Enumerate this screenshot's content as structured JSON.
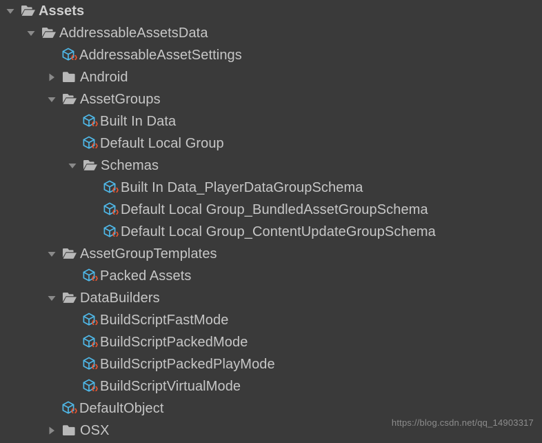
{
  "window": {
    "title": "Project Tree",
    "background_color": "#3a3a3a",
    "text_color": "#c6c6c6",
    "folder_color": "#b8b8b8",
    "twisty_color": "#8a8a8a",
    "cube_color": "#4fb8e8",
    "brace_color": "#f0552f"
  },
  "watermark": {
    "text": "https://blog.csdn.net/qq_14903317"
  },
  "tree": {
    "rows": [
      {
        "label": "Assets",
        "depth": 0,
        "icon": "folder-open-icon",
        "twisty": "chevron-down-icon",
        "bold": true
      },
      {
        "label": "AddressableAssetsData",
        "depth": 1,
        "icon": "folder-open-icon",
        "twisty": "chevron-down-icon",
        "bold": false
      },
      {
        "label": "AddressableAssetSettings",
        "depth": 2,
        "icon": "script-object-icon",
        "twisty": "none",
        "bold": false
      },
      {
        "label": "Android",
        "depth": 2,
        "icon": "folder-closed-icon",
        "twisty": "chevron-right-icon",
        "bold": false
      },
      {
        "label": "AssetGroups",
        "depth": 2,
        "icon": "folder-open-icon",
        "twisty": "chevron-down-icon",
        "bold": false
      },
      {
        "label": "Built In Data",
        "depth": 3,
        "icon": "script-object-icon",
        "twisty": "none",
        "bold": false
      },
      {
        "label": "Default Local Group",
        "depth": 3,
        "icon": "script-object-icon",
        "twisty": "none",
        "bold": false
      },
      {
        "label": "Schemas",
        "depth": 3,
        "icon": "folder-open-icon",
        "twisty": "chevron-down-icon",
        "bold": false
      },
      {
        "label": "Built In Data_PlayerDataGroupSchema",
        "depth": 4,
        "icon": "script-object-icon",
        "twisty": "none",
        "bold": false
      },
      {
        "label": "Default Local Group_BundledAssetGroupSchema",
        "depth": 4,
        "icon": "script-object-icon",
        "twisty": "none",
        "bold": false
      },
      {
        "label": "Default Local Group_ContentUpdateGroupSchema",
        "depth": 4,
        "icon": "script-object-icon",
        "twisty": "none",
        "bold": false
      },
      {
        "label": "AssetGroupTemplates",
        "depth": 2,
        "icon": "folder-open-icon",
        "twisty": "chevron-down-icon",
        "bold": false
      },
      {
        "label": "Packed Assets",
        "depth": 3,
        "icon": "script-object-icon",
        "twisty": "none",
        "bold": false
      },
      {
        "label": "DataBuilders",
        "depth": 2,
        "icon": "folder-open-icon",
        "twisty": "chevron-down-icon",
        "bold": false
      },
      {
        "label": "BuildScriptFastMode",
        "depth": 3,
        "icon": "script-object-icon",
        "twisty": "none",
        "bold": false
      },
      {
        "label": "BuildScriptPackedMode",
        "depth": 3,
        "icon": "script-object-icon",
        "twisty": "none",
        "bold": false
      },
      {
        "label": "BuildScriptPackedPlayMode",
        "depth": 3,
        "icon": "script-object-icon",
        "twisty": "none",
        "bold": false
      },
      {
        "label": "BuildScriptVirtualMode",
        "depth": 3,
        "icon": "script-object-icon",
        "twisty": "none",
        "bold": false
      },
      {
        "label": "DefaultObject",
        "depth": 2,
        "icon": "script-object-icon",
        "twisty": "none",
        "bold": false
      },
      {
        "label": "OSX",
        "depth": 2,
        "icon": "folder-closed-icon",
        "twisty": "chevron-right-icon",
        "bold": false
      }
    ]
  }
}
